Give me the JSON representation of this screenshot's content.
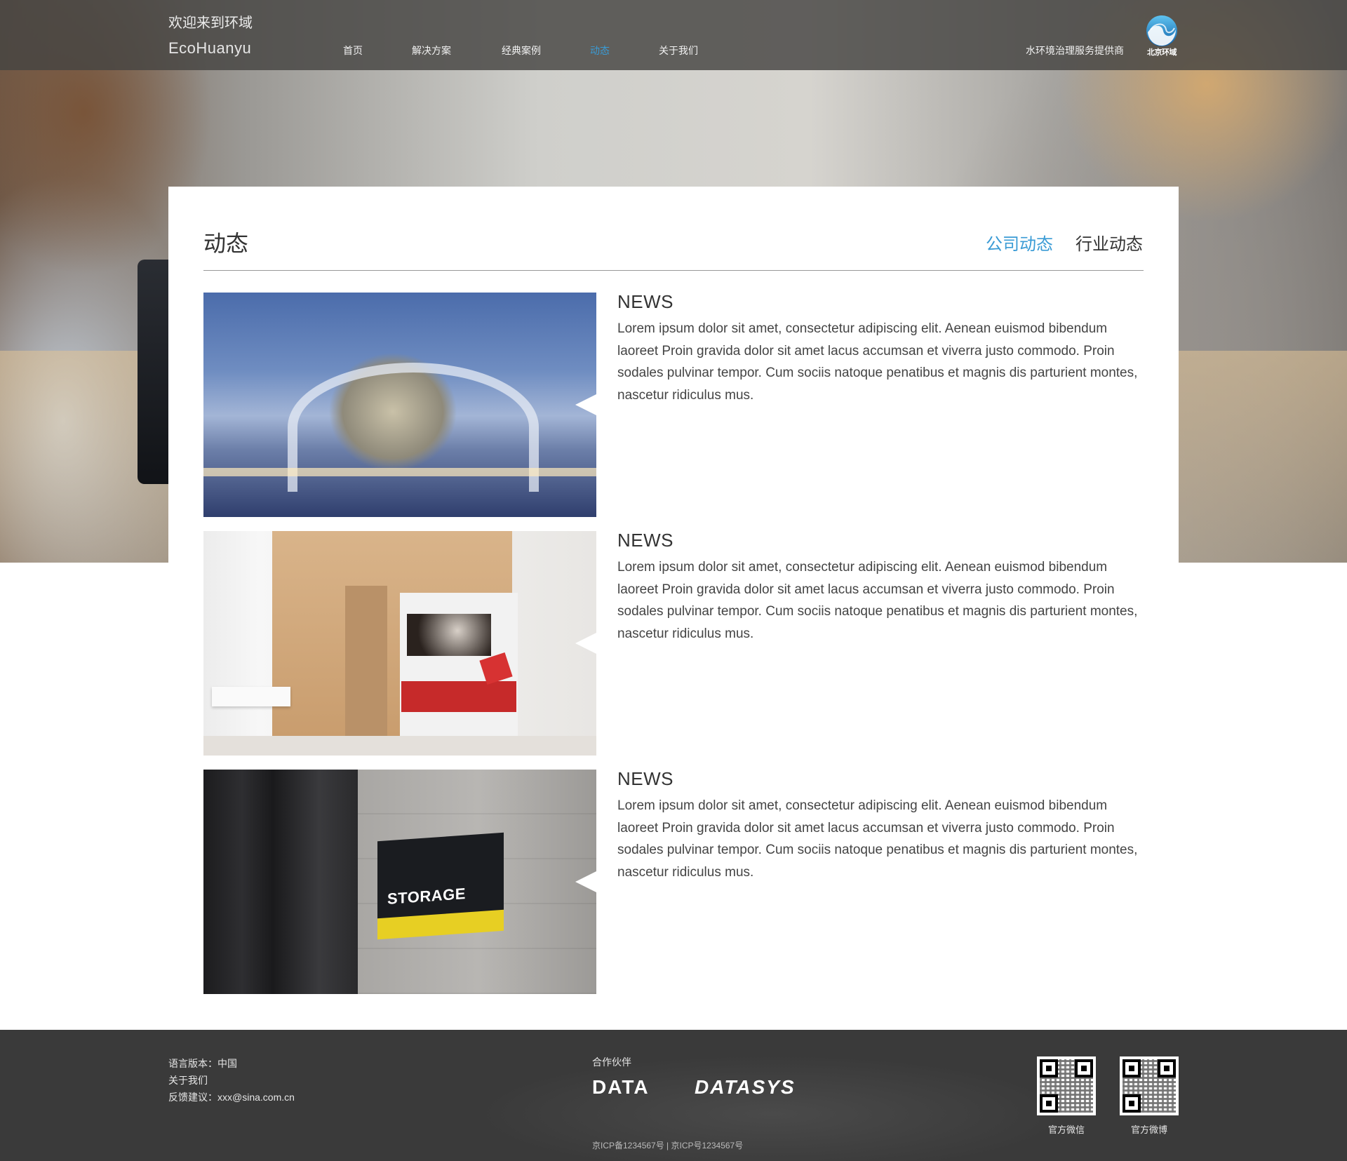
{
  "header": {
    "welcome": "欢迎来到环域",
    "brand": "EcoHuanyu",
    "nav": [
      {
        "label": "首页",
        "active": false
      },
      {
        "label": "解决方案",
        "active": false
      },
      {
        "label": "经典案例",
        "active": false
      },
      {
        "label": "动态",
        "active": true
      },
      {
        "label": "关于我们",
        "active": false
      }
    ],
    "tagline": "水环境治理服务提供商",
    "logo_text": "北京环域",
    "logo_icon": "wave-logo-icon"
  },
  "content": {
    "title": "动态",
    "tabs": [
      {
        "label": "公司动态",
        "active": true
      },
      {
        "label": "行业动态",
        "active": false
      }
    ],
    "news": [
      {
        "label": "NEWS",
        "body": "Lorem ipsum dolor sit amet, consectetur adipiscing elit. Aenean euismod bibendum laoreet Proin gravida dolor sit amet lacus accumsan et viverra justo commodo. Proin sodales pulvinar tempor. Cum sociis natoque penatibus et magnis dis parturient montes, nascetur ridiculus mus.",
        "image": "architecture-photo"
      },
      {
        "label": "NEWS",
        "body": "Lorem ipsum dolor sit amet, consectetur adipiscing elit. Aenean euismod bibendum laoreet Proin gravida dolor sit amet lacus accumsan et viverra justo commodo. Proin sodales pulvinar tempor. Cum sociis natoque penatibus et magnis dis parturient montes, nascetur ridiculus mus.",
        "image": "interior-photo"
      },
      {
        "label": "NEWS",
        "body": "Lorem ipsum dolor sit amet, consectetur adipiscing elit. Aenean euismod bibendum laoreet Proin gravida dolor sit amet lacus accumsan et viverra justo commodo. Proin sodales pulvinar tempor. Cum sociis natoque penatibus et magnis dis parturient montes, nascetur ridiculus mus.",
        "image": "storage-sign-photo",
        "sign_text": "STORAGE"
      }
    ]
  },
  "footer": {
    "language": "语言版本：中国",
    "about": "关于我们",
    "feedback": "反馈建议：xxx@sina.com.cn",
    "partners_title": "合作伙伴",
    "partners": [
      "DATA",
      "DATASYS"
    ],
    "icp": "京ICP备1234567号 | 京ICP号1234567号",
    "qr": [
      {
        "label": "官方微信",
        "icon": "qr-code-icon"
      },
      {
        "label": "官方微博",
        "icon": "qr-code-icon"
      }
    ]
  },
  "colors": {
    "accent": "#3a9bd5",
    "header_bg": "#464442",
    "footer_bg": "#3a3a3a",
    "text": "#333333"
  }
}
